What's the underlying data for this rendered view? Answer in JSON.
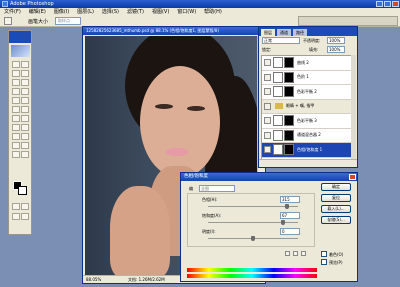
{
  "app": {
    "title": "Adobe Photoshop"
  },
  "menus": [
    "文件(F)",
    "编辑(E)",
    "图像(I)",
    "图层(L)",
    "选择(S)",
    "滤镜(T)",
    "视图(V)",
    "窗口(W)",
    "帮助(H)"
  ],
  "options": {
    "brush_label": "画笔大小",
    "brush_value": "取样点"
  },
  "document": {
    "title": "12582825623685_mthumb.psd @ 88.1% (色相/饱和度1, 图层蒙版/8)",
    "zoom": "88.05%",
    "doc_size": "文档: 1.26M/2.62M"
  },
  "layers_panel": {
    "tabs": [
      "图层",
      "通道",
      "路径"
    ],
    "blend_mode": "正常",
    "opacity_label": "不透明度:",
    "opacity_value": "100%",
    "lock_label": "锁定:",
    "fill_label": "填充:",
    "fill_value": "100%",
    "layers": [
      {
        "name": "曲线 2",
        "type": "adjust"
      },
      {
        "name": "色阶 1",
        "type": "adjust"
      },
      {
        "name": "色彩平衡 2",
        "type": "adjust"
      },
      {
        "name": "眼睛 + 嘴, 指甲",
        "type": "group"
      },
      {
        "name": "色彩平衡 3",
        "type": "adjust"
      },
      {
        "name": "通道混合器 2",
        "type": "adjust"
      },
      {
        "name": "色相/饱和度 1",
        "type": "adjust",
        "active": true
      }
    ]
  },
  "hue_sat_dialog": {
    "title": "色相/饱和度",
    "edit_label": "编",
    "edit_value": "全图",
    "hue_label": "色相(H):",
    "hue_value": "315",
    "hue_level": 0.875,
    "sat_label": "饱和度(A):",
    "sat_value": "67",
    "sat_level": 0.835,
    "light_label": "明度(I):",
    "light_value": "0",
    "light_level": 0.5,
    "buttons": {
      "ok": "确定",
      "cancel": "复位",
      "load": "载入(L)...",
      "save": "存储(S)..."
    },
    "colorize_label": "着色(O)",
    "preview_label": "预览(P)"
  },
  "colors": {
    "title_blue": "#0a3aa8",
    "panel_bg": "#ece9d8",
    "active_layer": "#1d46b4"
  }
}
